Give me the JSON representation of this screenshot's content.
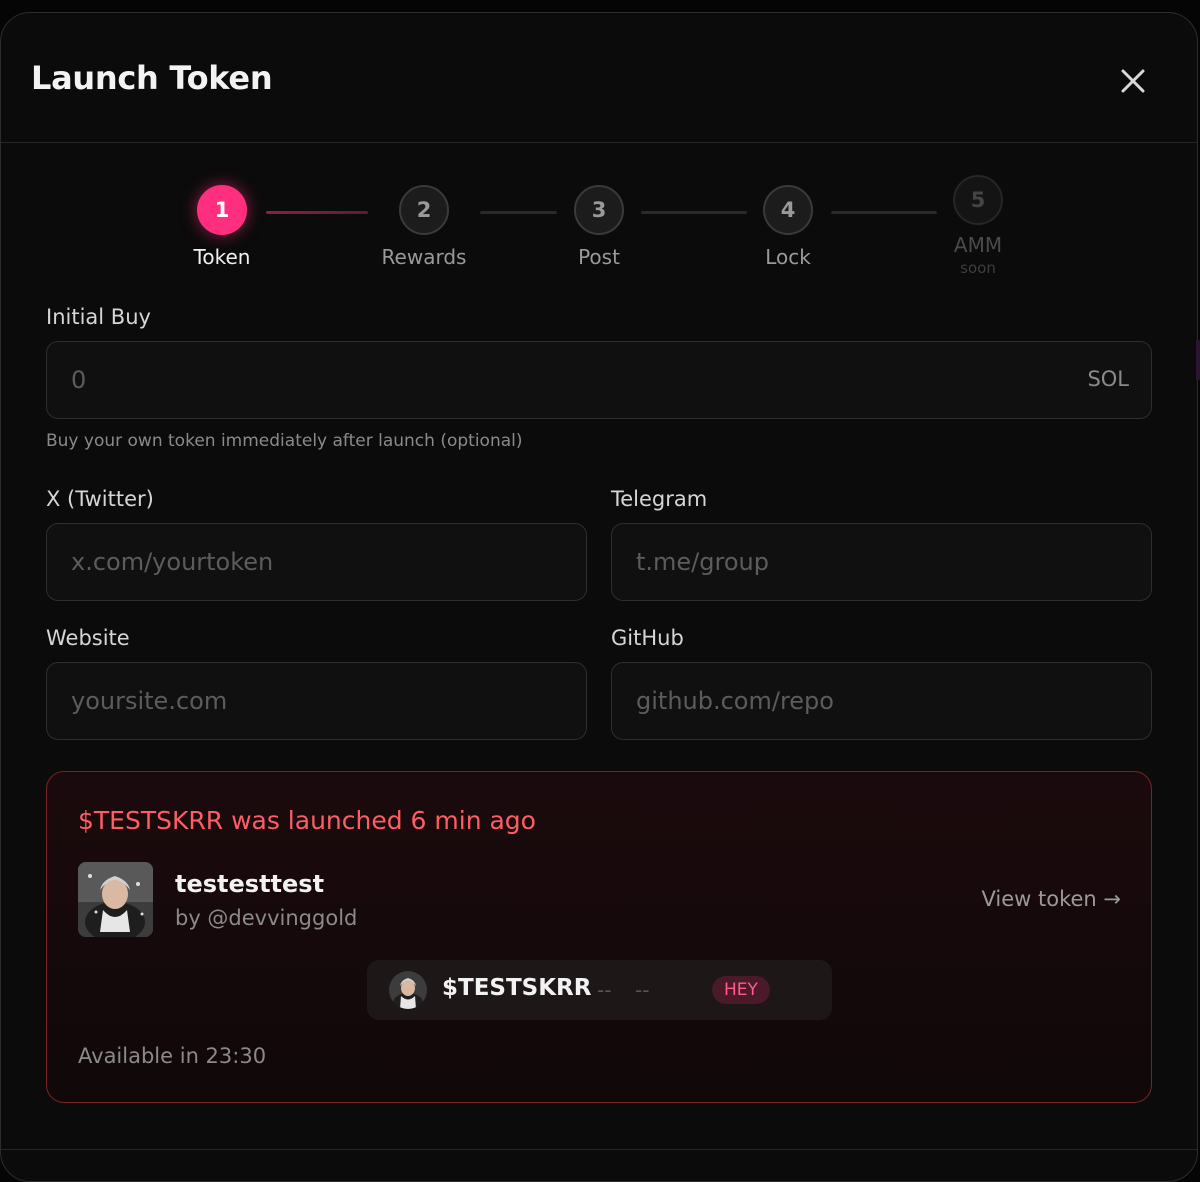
{
  "modal": {
    "title": "Launch Token"
  },
  "stepper": {
    "steps": [
      {
        "number": "1",
        "label": "Token",
        "state": "active"
      },
      {
        "number": "2",
        "label": "Rewards",
        "state": "inactive"
      },
      {
        "number": "3",
        "label": "Post",
        "state": "inactive"
      },
      {
        "number": "4",
        "label": "Lock",
        "state": "inactive"
      },
      {
        "number": "5",
        "label": "AMM",
        "sublabel": "soon",
        "state": "disabled"
      }
    ]
  },
  "form": {
    "initial_buy": {
      "label": "Initial Buy",
      "placeholder": "0",
      "suffix": "SOL",
      "help": "Buy your own token immediately after launch (optional)"
    },
    "twitter": {
      "label": "X (Twitter)",
      "placeholder": "x.com/yourtoken"
    },
    "telegram": {
      "label": "Telegram",
      "placeholder": "t.me/group"
    },
    "website": {
      "label": "Website",
      "placeholder": "yoursite.com"
    },
    "github": {
      "label": "GitHub",
      "placeholder": "github.com/repo"
    }
  },
  "launch_notice": {
    "title": "$TESTSKRR was launched 6 min ago",
    "token_name": "testesttest",
    "by": "by @devvinggold",
    "view_link": "View token →",
    "ticker": {
      "symbol": "$TESTSKRR",
      "value1": "--",
      "value2": "--",
      "badge": "HEY"
    },
    "available": "Available in 23:30"
  },
  "colors": {
    "accent": "#ff2e7e",
    "alert": "#ff5c66",
    "background": "#0b0b0b"
  },
  "icons": {
    "close": "close-icon",
    "avatar": "user-avatar-image"
  }
}
